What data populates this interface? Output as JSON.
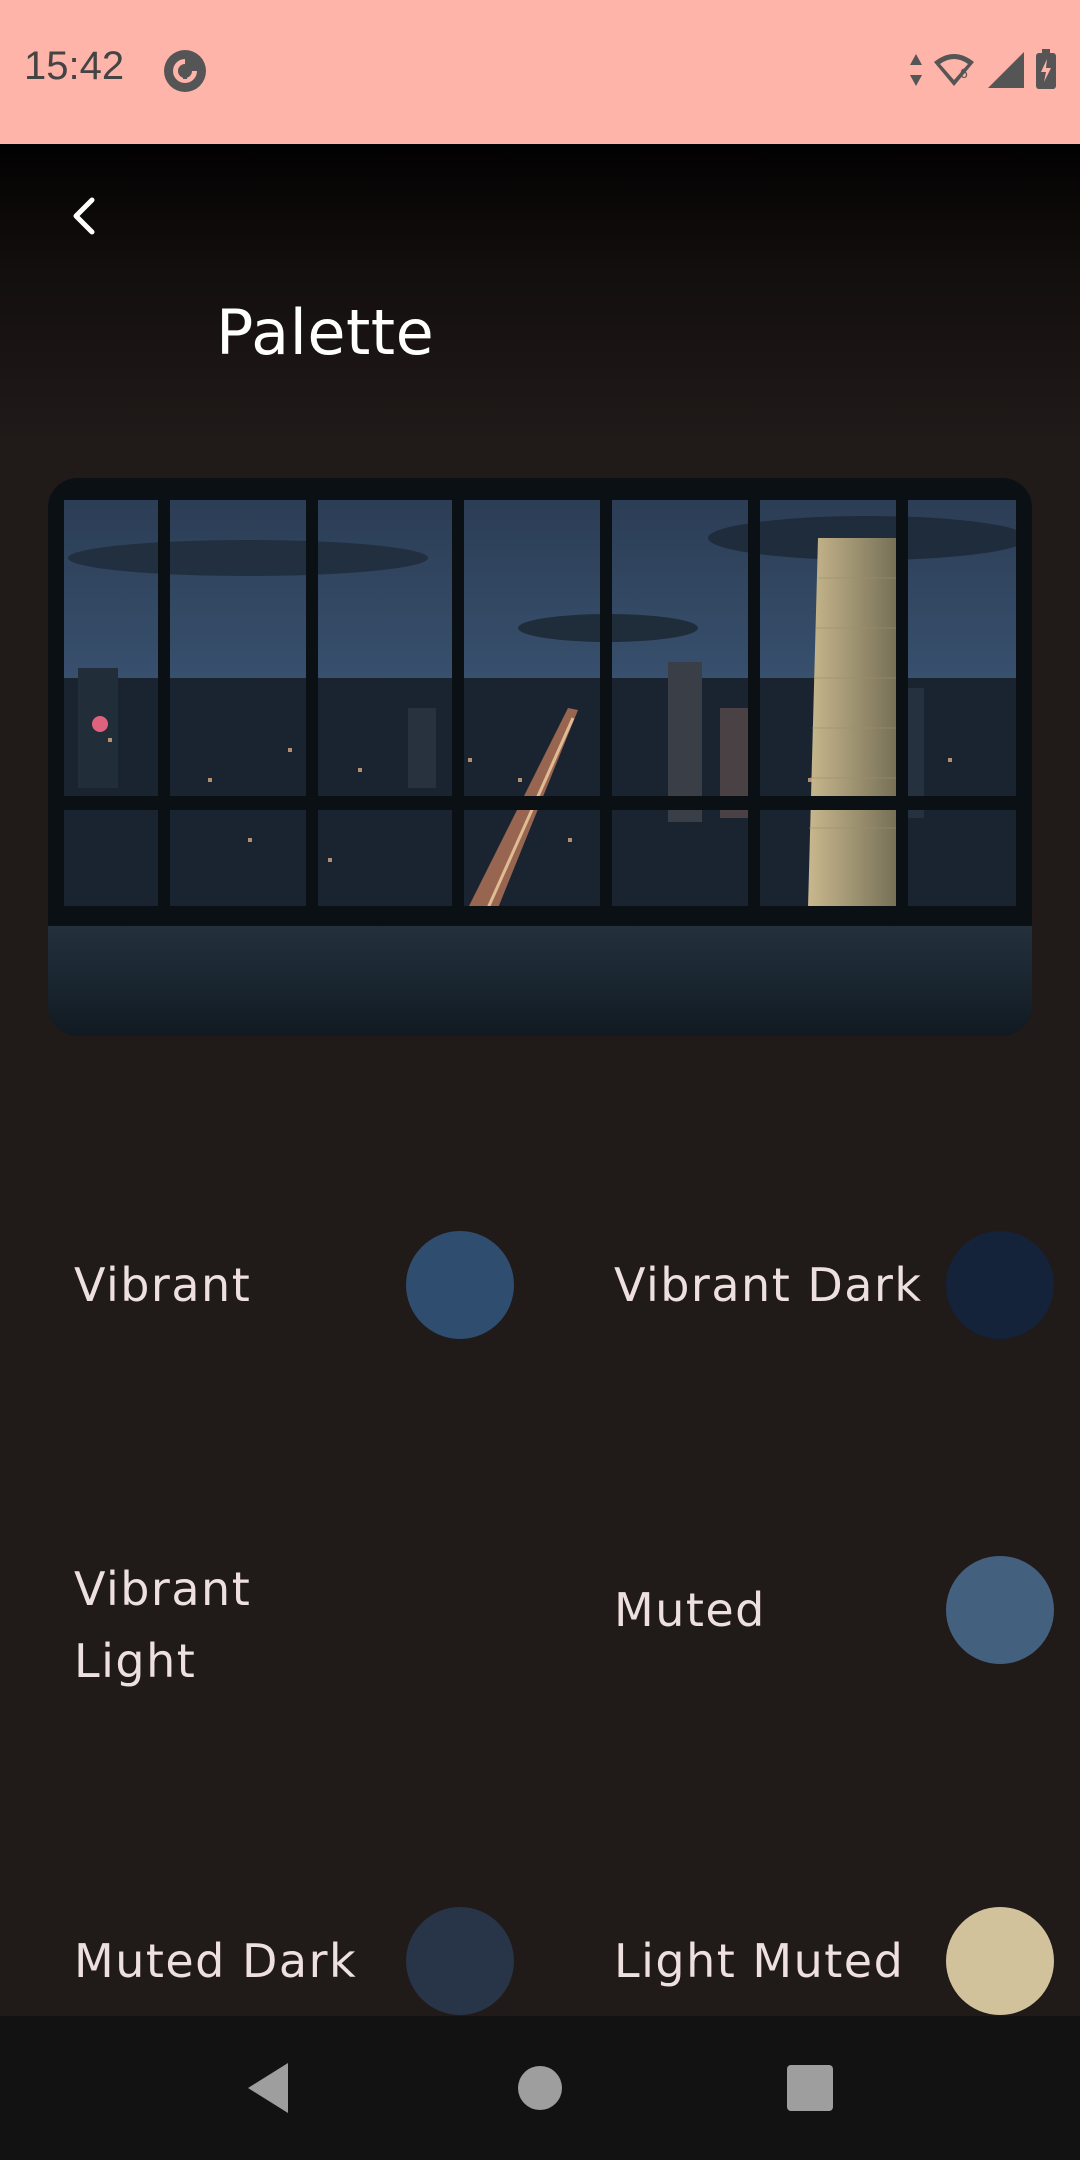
{
  "status_bar": {
    "time": "15:42",
    "icons": [
      "pocket-casts-icon",
      "data-arrows-icon",
      "wifi-icon",
      "cellular-signal-icon",
      "battery-charging-icon"
    ],
    "wifi_badge": "6",
    "background": "#ffb4a9"
  },
  "header": {
    "back_icon": "chevron-left-icon",
    "title": "Palette"
  },
  "hero": {
    "description_icon": "city-night-view-image"
  },
  "swatches": [
    {
      "label": "Vibrant",
      "color": "#2f4d6e"
    },
    {
      "label": "Vibrant Dark",
      "color": "#14223a"
    },
    {
      "label": "Vibrant\nLight",
      "color": null
    },
    {
      "label": "Muted",
      "color": "#44607f"
    },
    {
      "label": "Muted Dark",
      "color": "#283447"
    },
    {
      "label": "Light Muted",
      "color": "#d2c29c"
    }
  ],
  "navigation": {
    "back_icon": "triangle-back-icon",
    "home_icon": "circle-home-icon",
    "recents_icon": "square-recents-icon"
  },
  "colors": {
    "background": "#201a19",
    "text": "#ede0de",
    "nav_bar": "#121212"
  }
}
